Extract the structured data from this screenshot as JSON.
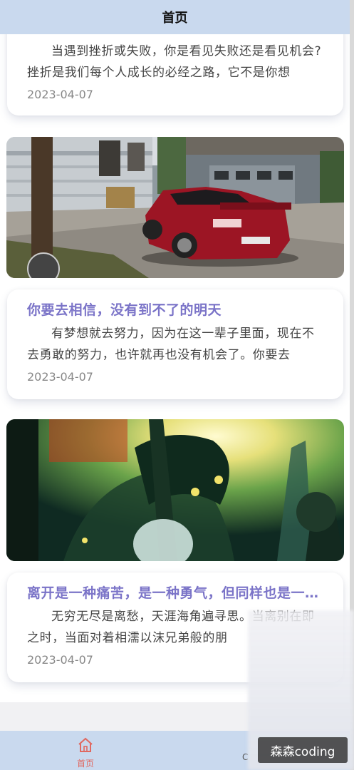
{
  "header": {
    "title": "首页"
  },
  "posts": [
    {
      "excerpt": "当遇到挫折或失败，你是看见失败还是看见机会?挫折是我们每个人成长的必经之路，它不是你想",
      "date": "2023-04-07"
    },
    {
      "title": "你要去相信，没有到不了的明天",
      "excerpt": "有梦想就去努力，因为在这一辈子里面，现在不去勇敢的努力，也许就再也没有机会了。你要去",
      "date": "2023-04-07"
    },
    {
      "title": "离开是一种痛苦，是一种勇气，但同样也是一种保护",
      "excerpt": "无穷无尽是离愁，天涯海角遍寻思。当离别在即之时，当面对着相濡以沫兄弟般的朋",
      "date": "2023-04-07"
    }
  ],
  "tabbar": {
    "home_label": "首页",
    "mine_label": "C"
  },
  "watermark": "森森coding",
  "colors": {
    "header_bg": "#c9d9ee",
    "title": "#7b74c8",
    "active_tab": "#e06860"
  },
  "icons": {
    "home": "home-icon"
  }
}
